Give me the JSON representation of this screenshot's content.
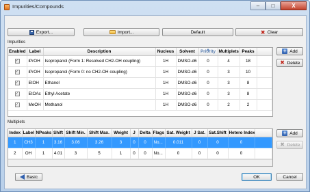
{
  "window": {
    "title": "Impurities/Compounds",
    "minimize": "–",
    "maximize": "□",
    "close": "X"
  },
  "toolbar": {
    "export_label": "Export...",
    "import_label": "Import...",
    "default_label": "Default",
    "clear_label": "Clear"
  },
  "impurities": {
    "section_label": "Impurities",
    "columns": [
      "Enabled",
      "Label",
      "Description",
      "Nucleus",
      "Solvent",
      "Priority",
      "Multiplets",
      "Peaks"
    ],
    "rows": [
      {
        "enabled": true,
        "label": "iPrOH",
        "description": "Isopropanol (Form 1: Resolved CH2-OH coupling)",
        "nucleus": "1H",
        "solvent": "DMSO-d6",
        "priority": "0",
        "multiplets": "4",
        "peaks": "18"
      },
      {
        "enabled": true,
        "label": "iPrOH",
        "description": "Isopropanol (Form 0: no CH2-OH coupling)",
        "nucleus": "1H",
        "solvent": "DMSO-d6",
        "priority": "0",
        "multiplets": "3",
        "peaks": "10"
      },
      {
        "enabled": true,
        "label": "EtOH",
        "description": "Ethanol",
        "nucleus": "1H",
        "solvent": "DMSO-d6",
        "priority": "0",
        "multiplets": "3",
        "peaks": "8"
      },
      {
        "enabled": true,
        "label": "EtOAc",
        "description": "Ethyl Acetate",
        "nucleus": "1H",
        "solvent": "DMSO-d6",
        "priority": "0",
        "multiplets": "3",
        "peaks": "8"
      },
      {
        "enabled": true,
        "label": "MeOH",
        "description": "Methanol",
        "nucleus": "1H",
        "solvent": "DMSO-d6",
        "priority": "0",
        "multiplets": "2",
        "peaks": "2"
      }
    ],
    "add_label": "Add",
    "delete_label": "Delete"
  },
  "multiplets": {
    "section_label": "Multiplets",
    "columns": [
      "Index",
      "Label",
      "NPeaks",
      "Shift",
      "Shift Min.",
      "Shift Max.",
      "Weight",
      "J",
      "Delta",
      "Flags",
      "Sat. Weight",
      "J Sat.",
      "Sat.Shift",
      "Hetero Index"
    ],
    "rows": [
      {
        "selected": true,
        "cells": [
          "1",
          "CH3",
          "1",
          "3.16",
          "3.06",
          "3.26",
          "3",
          "0",
          "0",
          "No...",
          "0.011",
          "0",
          "0",
          "0"
        ]
      },
      {
        "selected": false,
        "cells": [
          "2",
          "OH",
          "1",
          "4.01",
          "3",
          "5",
          "1",
          "0",
          "0",
          "No...",
          "0",
          "0",
          "0",
          "0"
        ]
      }
    ],
    "add_label": "Add",
    "delete_label": "Delete"
  },
  "footer": {
    "basic_label": "Basic",
    "ok_label": "OK",
    "cancel_label": "Cancel"
  }
}
